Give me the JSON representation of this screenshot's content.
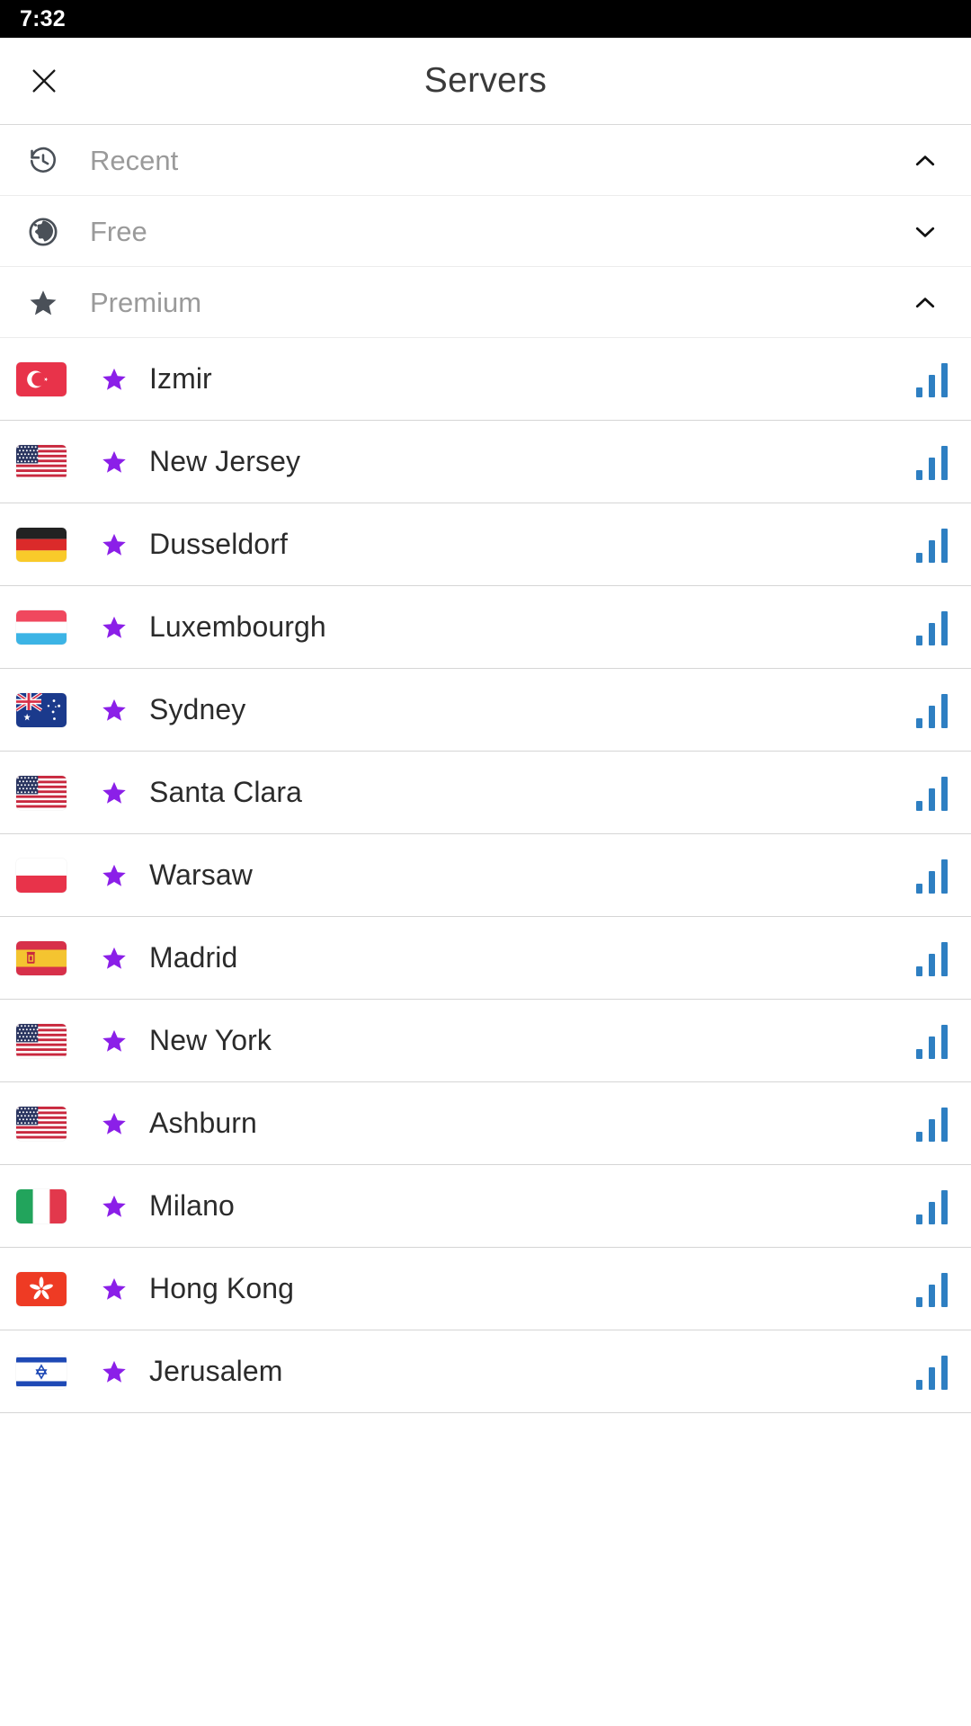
{
  "status_bar": {
    "time": "7:32"
  },
  "app_bar": {
    "title": "Servers",
    "close_icon": "close-icon"
  },
  "sections": [
    {
      "id": "recent",
      "label": "Recent",
      "icon": "history-icon",
      "expanded": true,
      "chevron": "chevron-up-icon"
    },
    {
      "id": "free",
      "label": "Free",
      "icon": "globe-icon",
      "expanded": false,
      "chevron": "chevron-down-icon"
    },
    {
      "id": "premium",
      "label": "Premium",
      "icon": "star-icon",
      "expanded": true,
      "chevron": "chevron-up-icon"
    }
  ],
  "colors": {
    "premium_star": "#8B1FE8",
    "signal_bars": "#2E7FC2",
    "section_label": "#9a9a9a",
    "server_name": "#2b2b2b",
    "status_bar_bg": "#000000",
    "title": "#3a3a3a"
  },
  "servers": [
    {
      "name": "Izmir",
      "country": "tr",
      "premium": true,
      "signal": 3
    },
    {
      "name": "New Jersey",
      "country": "us",
      "premium": true,
      "signal": 3
    },
    {
      "name": "Dusseldorf",
      "country": "de",
      "premium": true,
      "signal": 3
    },
    {
      "name": "Luxembourgh",
      "country": "lu",
      "premium": true,
      "signal": 3
    },
    {
      "name": "Sydney",
      "country": "au",
      "premium": true,
      "signal": 3
    },
    {
      "name": "Santa Clara",
      "country": "us",
      "premium": true,
      "signal": 3
    },
    {
      "name": "Warsaw",
      "country": "pl",
      "premium": true,
      "signal": 3
    },
    {
      "name": "Madrid",
      "country": "es",
      "premium": true,
      "signal": 3
    },
    {
      "name": "New York",
      "country": "us",
      "premium": true,
      "signal": 3
    },
    {
      "name": "Ashburn",
      "country": "us",
      "premium": true,
      "signal": 3
    },
    {
      "name": "Milano",
      "country": "it",
      "premium": true,
      "signal": 3
    },
    {
      "name": "Hong Kong",
      "country": "hk",
      "premium": true,
      "signal": 3
    },
    {
      "name": "Jerusalem",
      "country": "il",
      "premium": true,
      "signal": 3
    }
  ]
}
